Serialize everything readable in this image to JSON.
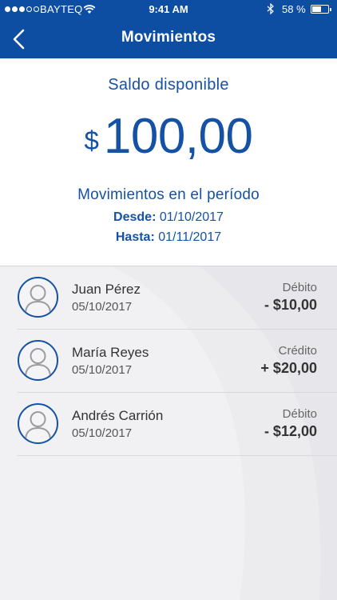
{
  "status_bar": {
    "carrier": "BAYTEQ",
    "time": "9:41 AM",
    "battery_text": "58 %",
    "battery_level": 0.58
  },
  "nav": {
    "title": "Movimientos",
    "back_icon": "chevron-left-icon"
  },
  "summary": {
    "label": "Saldo disponible",
    "currency": "$",
    "amount": "100,00",
    "period_title": "Movimientos en el período",
    "from_label": "Desde:",
    "from_value": "01/10/2017",
    "to_label": "Hasta:",
    "to_value": "01/11/2017"
  },
  "transactions": [
    {
      "name": "Juan Pérez",
      "date": "05/10/2017",
      "type": "Débito",
      "amount": "- $10,00",
      "icon": "user-avatar-icon"
    },
    {
      "name": "María Reyes",
      "date": "05/10/2017",
      "type": "Crédito",
      "amount": "+ $20,00",
      "icon": "user-avatar-icon"
    },
    {
      "name": "Andrés Carrión",
      "date": "05/10/2017",
      "type": "Débito",
      "amount": "- $12,00",
      "icon": "user-avatar-icon"
    }
  ],
  "colors": {
    "brand": "#0e4ea2",
    "accent_text": "#1552a5",
    "list_background": "#f1f1f3"
  }
}
